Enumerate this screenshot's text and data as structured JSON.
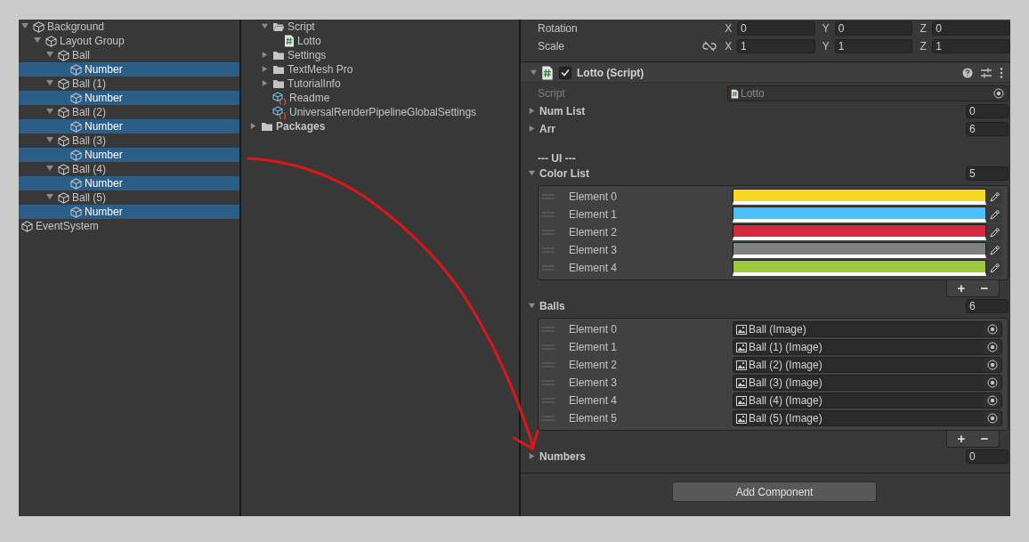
{
  "hierarchy": {
    "nested_items": [
      {
        "label": "Background",
        "expanded": true,
        "selected": false,
        "children": [
          {
            "label": "Layout Group",
            "expanded": true,
            "selected": false,
            "children": [
              {
                "label": "Ball",
                "expanded": true,
                "selected": false,
                "children": [
                  {
                    "label": "Number",
                    "selected": true
                  }
                ]
              },
              {
                "label": "Ball (1)",
                "expanded": true,
                "selected": false,
                "children": [
                  {
                    "label": "Number",
                    "selected": true
                  }
                ]
              },
              {
                "label": "Ball (2)",
                "expanded": true,
                "selected": false,
                "children": [
                  {
                    "label": "Number",
                    "selected": true
                  }
                ]
              },
              {
                "label": "Ball (3)",
                "expanded": true,
                "selected": false,
                "children": [
                  {
                    "label": "Number",
                    "selected": true
                  }
                ]
              },
              {
                "label": "Ball (4)",
                "expanded": true,
                "selected": false,
                "children": [
                  {
                    "label": "Number",
                    "selected": true
                  }
                ]
              },
              {
                "label": "Ball (5)",
                "expanded": true,
                "selected": false,
                "children": [
                  {
                    "label": "Number",
                    "selected": true
                  }
                ]
              }
            ]
          }
        ]
      }
    ],
    "root_items": [
      {
        "label": "EventSystem",
        "selected": false
      }
    ]
  },
  "project": {
    "nested_items": [
      {
        "label": "Script",
        "kind": "folder",
        "expanded": true,
        "children": [
          {
            "label": "Lotto",
            "kind": "script"
          }
        ]
      },
      {
        "label": "Settings",
        "kind": "folder",
        "expanded": false
      },
      {
        "label": "TextMesh Pro",
        "kind": "folder",
        "expanded": false
      },
      {
        "label": "TutorialInfo",
        "kind": "folder",
        "expanded": false
      },
      {
        "label": "Readme",
        "kind": "asset"
      },
      {
        "label": "UniversalRenderPipelineGlobalSettings",
        "kind": "asset"
      }
    ],
    "root_items": [
      {
        "label": "Packages",
        "kind": "folder",
        "expanded": false
      }
    ]
  },
  "inspector": {
    "transform": [
      {
        "label": "Rotation",
        "kind": "rotation",
        "values": [
          {
            "axis": "X",
            "value": "0"
          },
          {
            "axis": "Y",
            "value": "0"
          },
          {
            "axis": "Z",
            "value": "0"
          }
        ]
      },
      {
        "label": "Scale",
        "kind": "scale",
        "values": [
          {
            "axis": "X",
            "value": "1"
          },
          {
            "axis": "Y",
            "value": "1"
          },
          {
            "axis": "Z",
            "value": "1"
          }
        ]
      }
    ],
    "component": {
      "title": "Lotto (Script)",
      "enabled": true,
      "expanded": true,
      "script": {
        "label": "Script",
        "value": "Lotto",
        "disabled": true
      },
      "fields": [
        {
          "kind": "array",
          "label": "Num List",
          "expanded": false,
          "size": "0"
        },
        {
          "kind": "array",
          "label": "Arr",
          "expanded": false,
          "size": "6"
        },
        {
          "kind": "header",
          "label": "--- UI ---"
        },
        {
          "kind": "array",
          "label": "Color List",
          "expanded": true,
          "size": "5",
          "elements": [
            {
              "kind": "color",
              "label": "Element 0",
              "color": "#f9d824"
            },
            {
              "kind": "color",
              "label": "Element 1",
              "color": "#4abffb"
            },
            {
              "kind": "color",
              "label": "Element 2",
              "color": "#d52a3e"
            },
            {
              "kind": "color",
              "label": "Element 3",
              "color": "#808080"
            },
            {
              "kind": "color",
              "label": "Element 4",
              "color": "#9bcb3c"
            }
          ],
          "buttons": [
            "+",
            "−"
          ]
        },
        {
          "kind": "array",
          "label": "Balls",
          "expanded": true,
          "size": "6",
          "elements": [
            {
              "kind": "object",
              "label": "Element 0",
              "value": "Ball (Image)"
            },
            {
              "kind": "object",
              "label": "Element 1",
              "value": "Ball (1) (Image)"
            },
            {
              "kind": "object",
              "label": "Element 2",
              "value": "Ball (2) (Image)"
            },
            {
              "kind": "object",
              "label": "Element 3",
              "value": "Ball (3) (Image)"
            },
            {
              "kind": "object",
              "label": "Element 4",
              "value": "Ball (4) (Image)"
            },
            {
              "kind": "object",
              "label": "Element 5",
              "value": "Ball (5) (Image)"
            }
          ],
          "buttons": [
            "+",
            "−"
          ]
        },
        {
          "kind": "array",
          "label": "Numbers",
          "expanded": false,
          "size": "0"
        }
      ]
    },
    "add_button": "Add Component"
  }
}
